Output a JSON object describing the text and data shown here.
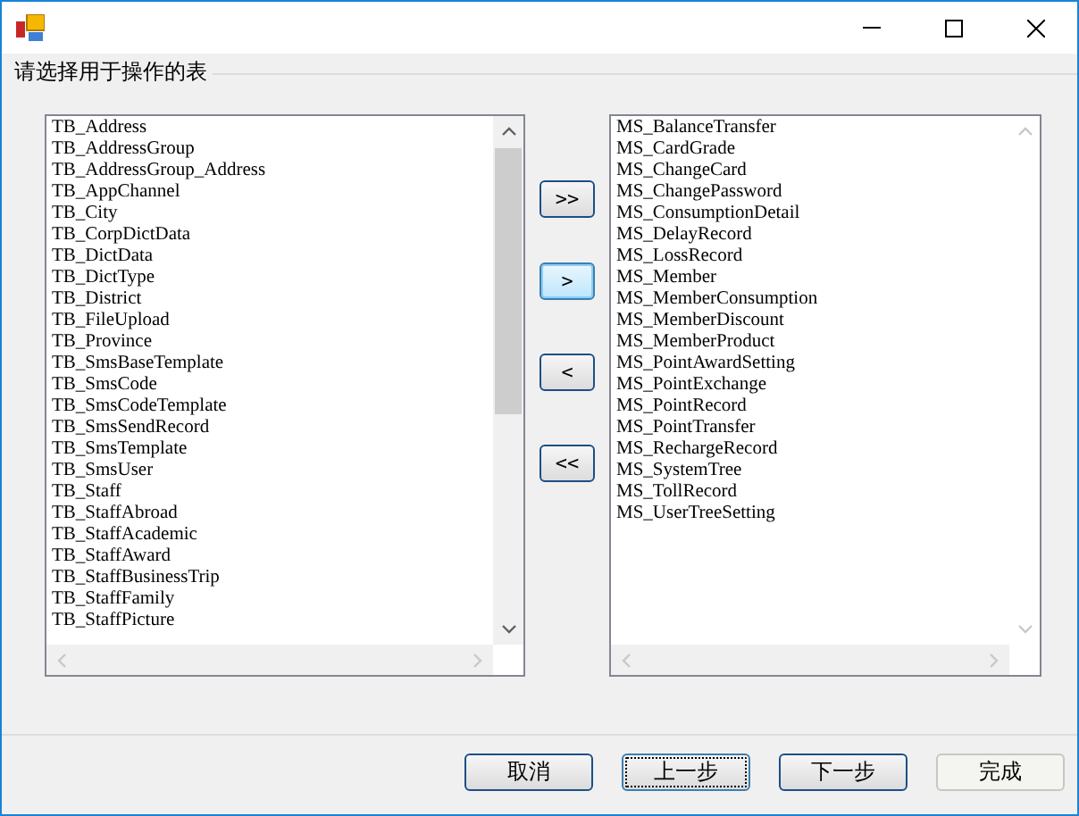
{
  "group_label": "请选择用于操作的表",
  "available_tables": [
    "TB_Address",
    "TB_AddressGroup",
    "TB_AddressGroup_Address",
    "TB_AppChannel",
    "TB_City",
    "TB_CorpDictData",
    "TB_DictData",
    "TB_DictType",
    "TB_District",
    "TB_FileUpload",
    "TB_Province",
    "TB_SmsBaseTemplate",
    "TB_SmsCode",
    "TB_SmsCodeTemplate",
    "TB_SmsSendRecord",
    "TB_SmsTemplate",
    "TB_SmsUser",
    "TB_Staff",
    "TB_StaffAbroad",
    "TB_StaffAcademic",
    "TB_StaffAward",
    "TB_StaffBusinessTrip",
    "TB_StaffFamily",
    "TB_StaffPicture"
  ],
  "move_buttons": [
    {
      "label": ">>",
      "focused": false
    },
    {
      "label": ">",
      "focused": true
    },
    {
      "label": "<",
      "focused": false
    },
    {
      "label": "<<",
      "focused": false
    }
  ],
  "selected_tables": [
    "MS_BalanceTransfer",
    "MS_CardGrade",
    "MS_ChangeCard",
    "MS_ChangePassword",
    "MS_ConsumptionDetail",
    "MS_DelayRecord",
    "MS_LossRecord",
    "MS_Member",
    "MS_MemberConsumption",
    "MS_MemberDiscount",
    "MS_MemberProduct",
    "MS_PointAwardSetting",
    "MS_PointExchange",
    "MS_PointRecord",
    "MS_PointTransfer",
    "MS_RechargeRecord",
    "MS_SystemTree",
    "MS_TollRecord",
    "MS_UserTreeSetting"
  ],
  "buttons": [
    {
      "label": "取消",
      "focused": false,
      "disabled": false
    },
    {
      "label": "上一步",
      "focused": true,
      "disabled": false
    },
    {
      "label": "下一步",
      "focused": false,
      "disabled": false
    },
    {
      "label": "完成",
      "focused": false,
      "disabled": true
    }
  ]
}
